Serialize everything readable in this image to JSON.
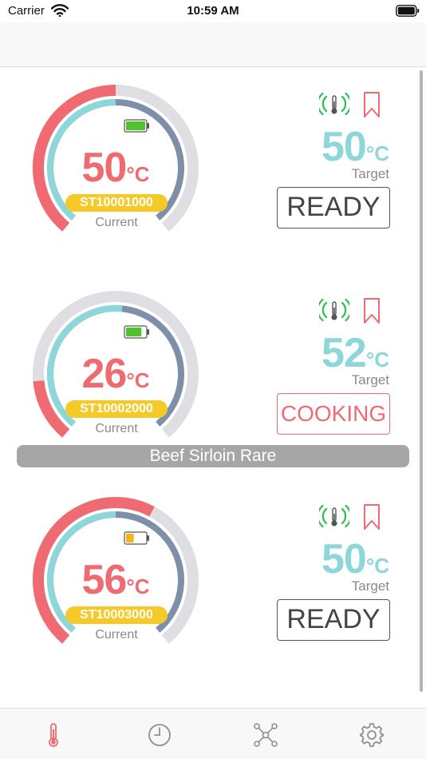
{
  "status_bar": {
    "carrier": "Carrier",
    "time": "10:59 AM"
  },
  "colors": {
    "accent_red": "#f06a72",
    "accent_teal": "#8dd6d9",
    "gauge_track": "#dedee3",
    "gauge_target": "#7e8faa",
    "badge_yellow": "#f4c928",
    "signal_green": "#2bbf52"
  },
  "probes": [
    {
      "current": "50",
      "unit": "°C",
      "probe_id": "ST10001000",
      "current_label": "Current",
      "target": "50",
      "target_label": "Target",
      "status": "READY",
      "battery": 1.0,
      "current_fraction": 0.5,
      "target_fraction": 0.5
    },
    {
      "current": "26",
      "unit": "°C",
      "probe_id": "ST10002000",
      "current_label": "Current",
      "target": "52",
      "target_label": "Target",
      "status": "COOKING",
      "battery": 0.8,
      "current_fraction": 0.16,
      "target_fraction": 0.52,
      "recipe": "Beef Sirloin Rare"
    },
    {
      "current": "56",
      "unit": "°C",
      "probe_id": "ST10003000",
      "current_label": "Current",
      "target": "50",
      "target_label": "Target",
      "status": "READY",
      "battery": 0.4,
      "current_fraction": 0.6,
      "target_fraction": 0.5
    }
  ],
  "tabs": [
    {
      "icon": "thermometer-icon",
      "active": true
    },
    {
      "icon": "clock-icon",
      "active": false
    },
    {
      "icon": "network-icon",
      "active": false
    },
    {
      "icon": "gear-icon",
      "active": false
    }
  ]
}
